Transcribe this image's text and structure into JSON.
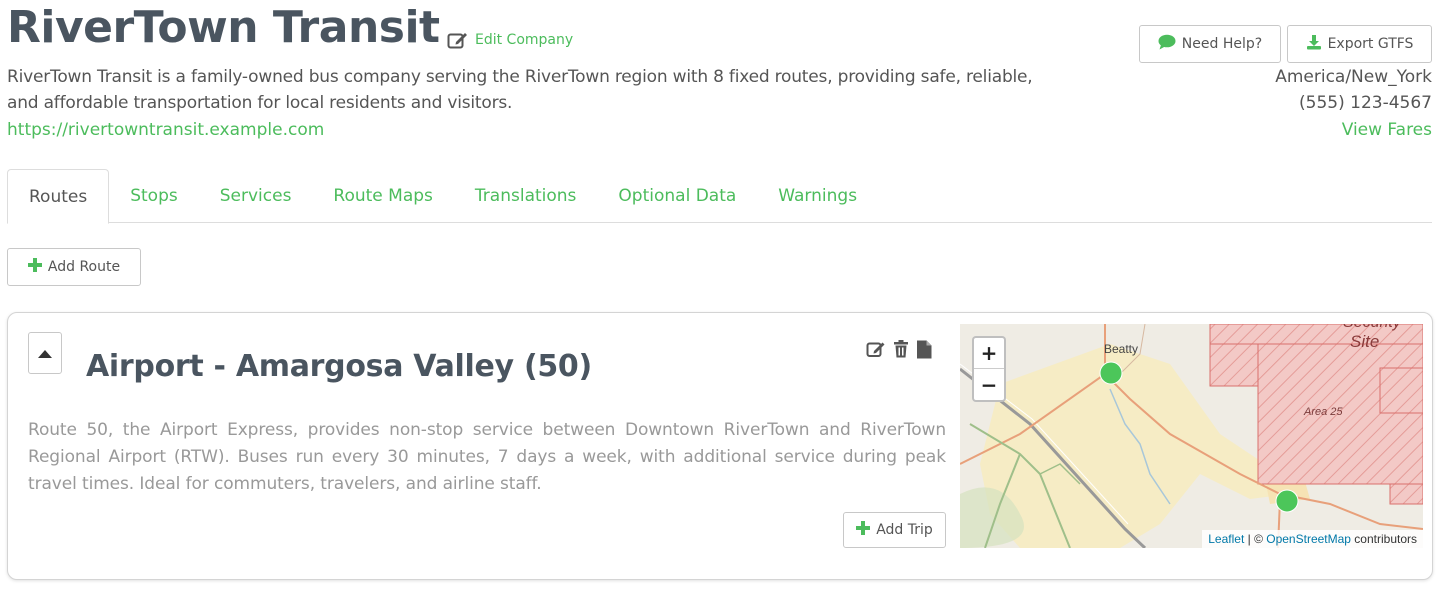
{
  "company": {
    "name": "RiverTown Transit",
    "edit_label": "Edit Company",
    "description": "RiverTown Transit is a family-owned bus company serving the RiverTown region with 8 fixed routes, providing safe, reliable, and affordable transportation for local residents and visitors.",
    "url": "https://rivertowntransit.example.com",
    "timezone": "America/New_York",
    "phone": "(555) 123-4567",
    "fares_label": "View Fares"
  },
  "header_buttons": {
    "help_label": "Need Help?",
    "export_label": "Export GTFS"
  },
  "tabs": [
    {
      "label": "Routes",
      "active": true
    },
    {
      "label": "Stops",
      "active": false
    },
    {
      "label": "Services",
      "active": false
    },
    {
      "label": "Route Maps",
      "active": false
    },
    {
      "label": "Translations",
      "active": false
    },
    {
      "label": "Optional Data",
      "active": false
    },
    {
      "label": "Warnings",
      "active": false
    }
  ],
  "actions": {
    "add_route_label": "Add Route"
  },
  "route": {
    "title": "Airport - Amargosa Valley (50)",
    "description": "Route 50, the Airport Express, provides non-stop service between Downtown RiverTown and RiverTown Regional Airport (RTW). Buses run every 30 minutes, 7 days a week, with additional service during peak travel times. Ideal for commuters, travelers, and airline staff.",
    "add_trip_label": "Add Trip",
    "action_icons": [
      "edit-icon",
      "trash-icon",
      "file-icon"
    ]
  },
  "map": {
    "zoom_in": "+",
    "zoom_out": "−",
    "labels": {
      "town": "Beatty",
      "area": "Area 25",
      "site": "Site",
      "security": "Security"
    },
    "attribution": {
      "leaflet": "Leaflet",
      "separator": " | © ",
      "osm": "OpenStreetMap",
      "suffix": " contributors"
    }
  },
  "colors": {
    "accent": "#4cbc5c",
    "title": "#4a5560",
    "text": "#555555",
    "muted": "#999999",
    "stop_marker": "#4cc65a",
    "restricted_area": "#e8a0a0"
  }
}
